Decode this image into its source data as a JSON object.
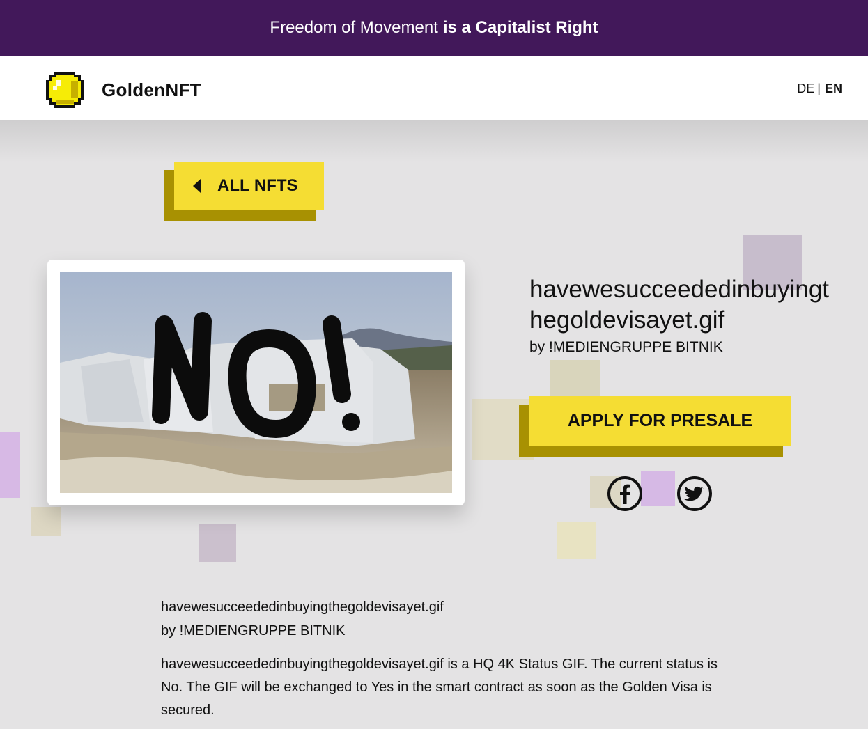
{
  "banner": {
    "light_text": "Freedom of Movement",
    "bold_text": "is a Capitalist Right"
  },
  "header": {
    "brand": "GoldenNFT",
    "lang_de": "DE",
    "lang_sep": "|",
    "lang_en": "EN",
    "active_lang": "EN"
  },
  "back_button": {
    "label": "ALL NFTS"
  },
  "nft": {
    "title": "havewesucceededinbuyingthegoldevisayet.gif",
    "author": "by !MEDIENGRUPPE BITNIK",
    "image_overlay": "NO!"
  },
  "presale": {
    "label": "APPLY FOR PRESALE"
  },
  "share": {
    "icons": [
      "facebook-icon",
      "twitter-icon"
    ]
  },
  "description": {
    "title": "havewesucceededinbuyingthegoldevisayet.gif",
    "author": "by !MEDIENGRUPPE BITNIK",
    "body": "havewesucceededinbuyingthegoldevisayet.gif is a HQ 4K Status GIF. The current status is No. The GIF will be exchanged to Yes in the smart contract as soon as the Golden Visa is secured."
  },
  "colors": {
    "banner_bg": "#42185a",
    "accent_yellow": "#f5dd33",
    "accent_shadow": "#a89102",
    "page_bg": "#e4e3e4"
  }
}
